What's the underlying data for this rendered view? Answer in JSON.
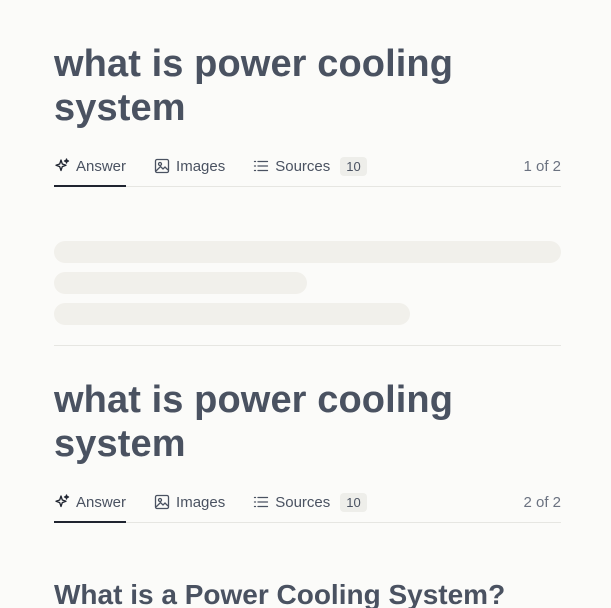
{
  "threads": [
    {
      "query": "what is power cooling system",
      "tabs": {
        "answer": "Answer",
        "images": "Images",
        "sources": "Sources",
        "sources_count": "10"
      },
      "pager": "1 of 2",
      "loading": true
    },
    {
      "query": "what is power cooling system",
      "tabs": {
        "answer": "Answer",
        "images": "Images",
        "sources": "Sources",
        "sources_count": "10"
      },
      "pager": "2 of 2",
      "answer_heading": "What is a Power Cooling System?"
    }
  ],
  "icons": {
    "answer": "sparkles-icon",
    "images": "image-icon",
    "sources": "list-icon"
  }
}
